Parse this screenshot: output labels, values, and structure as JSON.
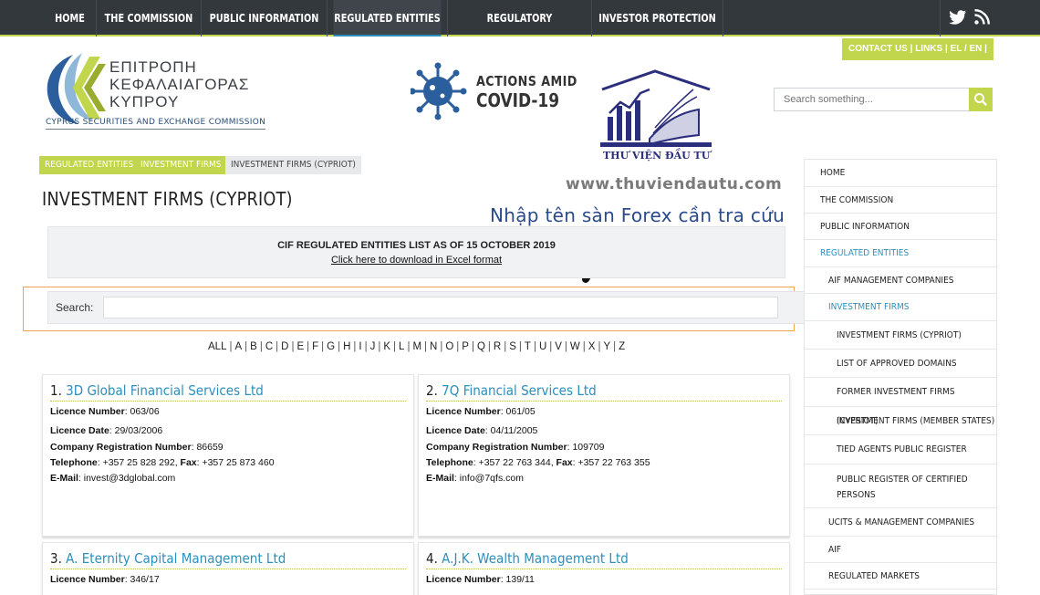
{
  "nav": {
    "items": [
      "HOME",
      "THE COMMISSION",
      "PUBLIC INFORMATION",
      "REGULATED ENTITIES",
      "REGULATORY FRAMEWORK",
      "INVESTOR PROTECTION"
    ],
    "active_index": 3
  },
  "contact_bar": {
    "contact": "CONTACT US",
    "links": "LINKS",
    "lang": "EL / EN"
  },
  "logo": {
    "greek_line1": "ΕΠΙΤΡΟΠΗ",
    "greek_line2": "ΚΕΦΑΛΑΙΑΓΟΡΑΣ",
    "greek_line3": "ΚΥΠΡΟΥ",
    "english": "CYPRUS SECURITIES AND EXCHANGE COMMISSION"
  },
  "covid": {
    "line1": "ACTIONS AMID",
    "line2": "COVID-19"
  },
  "watermark": {
    "caption": "THƯ VIỆN ĐẦU TƯ",
    "url": "www.thuviendautu.com",
    "note": "Nhập tên sàn Forex cần tra cứu"
  },
  "top_search": {
    "placeholder": "Search something..."
  },
  "breadcrumb": [
    "REGULATED ENTITIES",
    "INVESTMENT FIRMS",
    "INVESTMENT FIRMS (CYPRIOT)"
  ],
  "page_title": "INVESTMENT FIRMS (CYPRIOT)",
  "cif_box": {
    "heading": "CIF REGULATED ENTITIES LIST AS OF 15 OCTOBER 2019",
    "link": "Click here to download in Excel format"
  },
  "search": {
    "label": "Search:",
    "value": ""
  },
  "letters": [
    "ALL",
    "A",
    "B",
    "C",
    "D",
    "E",
    "F",
    "G",
    "H",
    "I",
    "J",
    "K",
    "L",
    "M",
    "N",
    "O",
    "P",
    "Q",
    "R",
    "S",
    "T",
    "U",
    "V",
    "W",
    "X",
    "Y",
    "Z"
  ],
  "firms": [
    {
      "num": "1.",
      "name": "3D Global Financial Services Ltd",
      "licence_number_label": "Licence Number",
      "licence_number": ": 063/06",
      "licence_date_label": "Licence Date",
      "licence_date": ": 29/03/2006",
      "reg_label": "Company Registration Number",
      "reg": ": 86659",
      "tel_label": "Telephone",
      "tel": ": +357 25 828 292, ",
      "fax_label": "Fax",
      "fax": ": +357 25 873 460",
      "email_label": "E-Mail",
      "email": ": invest@3dglobal.com"
    },
    {
      "num": "2.",
      "name": "7Q Financial Services Ltd",
      "licence_number_label": "Licence Number",
      "licence_number": ": 061/05",
      "licence_date_label": "Licence Date",
      "licence_date": ": 04/11/2005",
      "reg_label": "Company Registration Number",
      "reg": ": 109709",
      "tel_label": "Telephone",
      "tel": ": +357 22 763 344, ",
      "fax_label": "Fax",
      "fax": ": +357 22 763 355",
      "email_label": "E-Mail",
      "email": ": info@7qfs.com"
    },
    {
      "num": "3.",
      "name": "A. Eternity Capital Management Ltd",
      "licence_number_label": "Licence Number",
      "licence_number": ": 346/17"
    },
    {
      "num": "4.",
      "name": "A.J.K. Wealth Management Ltd",
      "licence_number_label": "Licence Number",
      "licence_number": ": 139/11"
    }
  ],
  "sidebar": [
    {
      "label": "HOME"
    },
    {
      "label": "THE COMMISSION"
    },
    {
      "label": "PUBLIC INFORMATION"
    },
    {
      "label": "REGULATED ENTITIES"
    },
    {
      "label": "AIF MANAGEMENT COMPANIES"
    },
    {
      "label": "INVESTMENT FIRMS"
    },
    {
      "label": "INVESTMENT FIRMS (CYPRIOT)"
    },
    {
      "label": "LIST OF APPROVED DOMAINS"
    },
    {
      "label": "FORMER INVESTMENT FIRMS (CYPRIOT)"
    },
    {
      "label": "INVESTMENT FIRMS (MEMBER STATES)"
    },
    {
      "label": "TIED AGENTS PUBLIC REGISTER"
    },
    {
      "label": "PUBLIC REGISTER OF CERTIFIED PERSONS"
    },
    {
      "label": "UCITS & MANAGEMENT COMPANIES"
    },
    {
      "label": "AIF"
    },
    {
      "label": "REGULATED MARKETS"
    }
  ],
  "colors": {
    "accent": "#c2d64d",
    "link": "#2b8fbd",
    "nav_bg": "#33383d",
    "highlight": "#f1a550"
  }
}
